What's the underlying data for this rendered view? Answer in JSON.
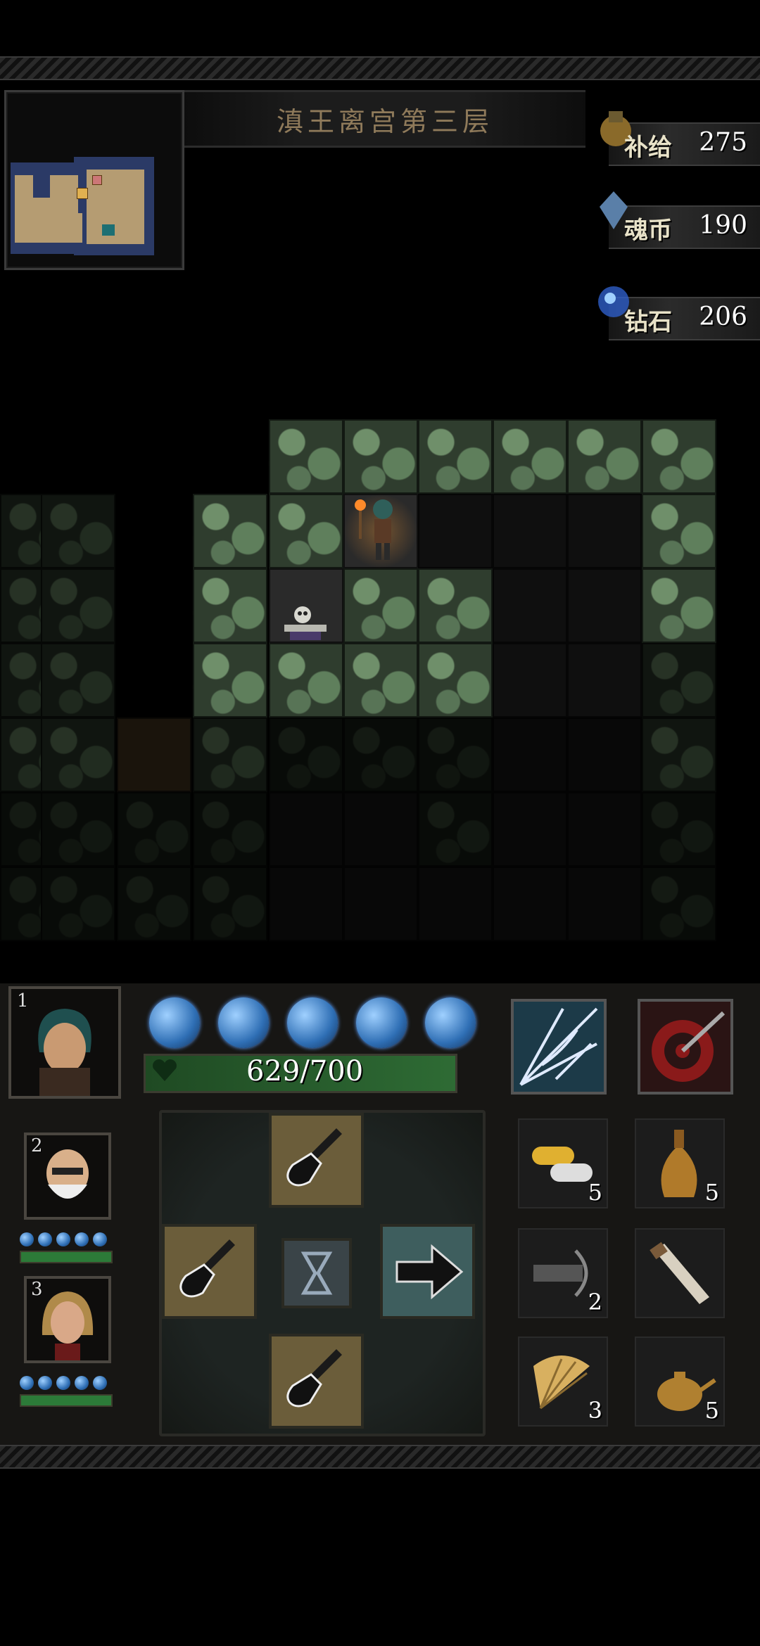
{
  "level": {
    "title": "滇王离宫第三层"
  },
  "resources": [
    {
      "label": "补给",
      "value": "275",
      "icon": "supply-icon"
    },
    {
      "label": "魂币",
      "value": "190",
      "icon": "soul-coin-icon"
    },
    {
      "label": "钻石",
      "value": "206",
      "icon": "diamond-icon"
    }
  ],
  "party": {
    "leader": {
      "slot": "1",
      "hp": "629/700",
      "hp_fraction": 0.9,
      "energy_orbs": 5
    },
    "members": [
      {
        "slot": "2",
        "energy_orbs": 5
      },
      {
        "slot": "3",
        "energy_orbs": 5
      }
    ]
  },
  "skills": [
    "web-skill-icon",
    "target-arrow-skill-icon"
  ],
  "controls": {
    "center": "hourglass-wait-icon",
    "right": "arrow-right-icon",
    "dig": "shovel-icon"
  },
  "items": [
    {
      "icon": "pill-icon",
      "count": "5"
    },
    {
      "icon": "bottle-icon",
      "count": "5"
    },
    {
      "icon": "crossbow-icon",
      "count": "2"
    },
    {
      "icon": "telescope-icon",
      "count": ""
    },
    {
      "icon": "fan-icon",
      "count": "3"
    },
    {
      "icon": "teapot-icon",
      "count": "5"
    }
  ],
  "colors": {
    "hp": "#2e6b34",
    "energy": "#2f6fb5",
    "stone": "#2f3d2e"
  }
}
